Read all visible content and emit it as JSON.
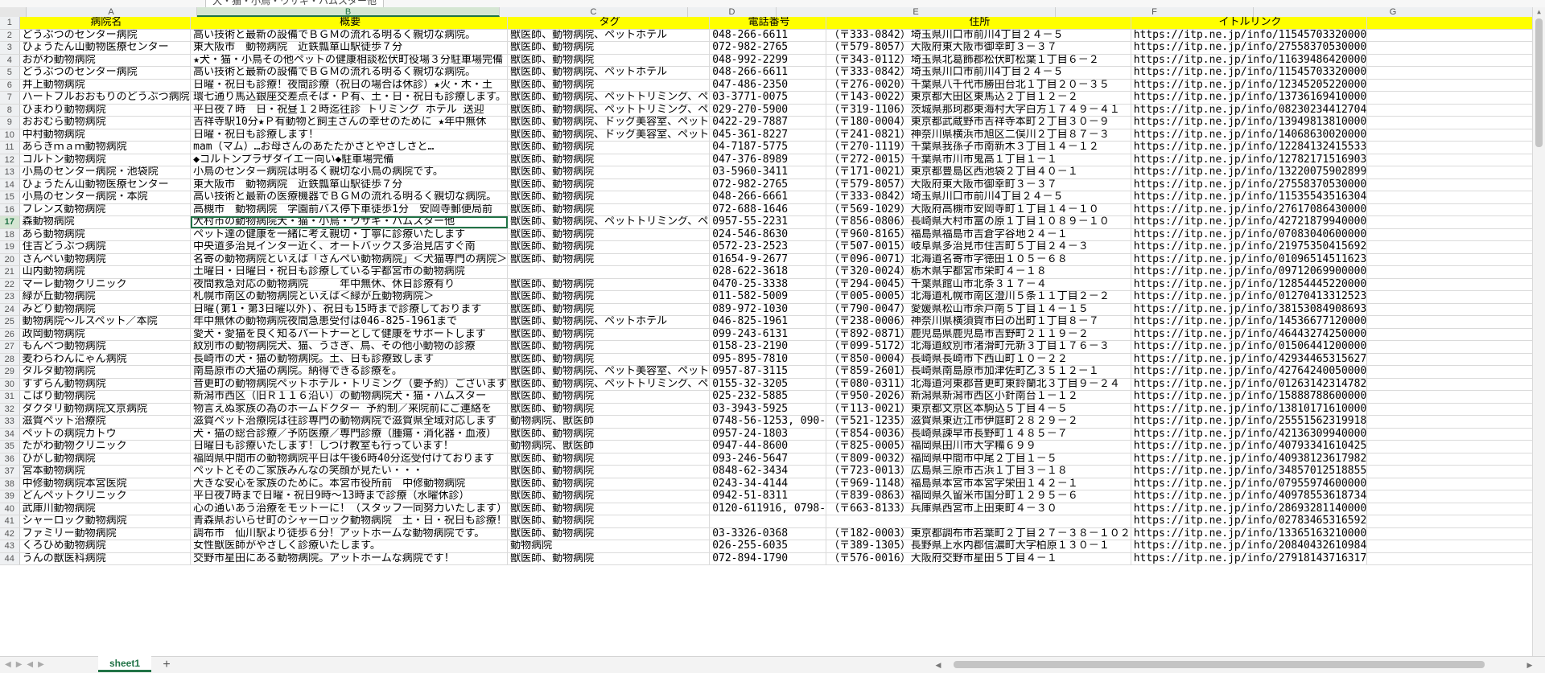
{
  "formula_bar": {
    "text": "犬・猫・小鳥・ウサギ・ハムスター他"
  },
  "column_letters": [
    "A",
    "B",
    "C",
    "D",
    "E",
    "F",
    "G"
  ],
  "header_row_number": "1",
  "headers": [
    "病院名",
    "概要",
    "タグ",
    "電話番号",
    "住所",
    "イトルリンク"
  ],
  "rows": [
    {
      "n": "2",
      "c": [
        "どうぶつのセンター病院",
        "高い技術と最新の設備でＢＧＭの流れる明るく親切な病院。",
        "獣医師、動物病院、ペットホテル",
        "048-266-6611",
        "（〒333-0842）埼玉県川口市前川4丁目２４－５",
        "https://itp.ne.jp/info/11545703320000"
      ]
    },
    {
      "n": "3",
      "c": [
        "ひょうたん山動物医療センター",
        "東大阪市　動物病院　近鉄瓢箪山駅徒歩７分",
        "獣医師、動物病院",
        "072-982-2765",
        "（〒579-8057）大阪府東大阪市御幸町３－３７",
        "https://itp.ne.jp/info/27558370530000"
      ]
    },
    {
      "n": "4",
      "c": [
        "おがわ動物病院",
        "★犬・猫・小鳥その他ペットの健康相談松伏町役場３分駐車場完備",
        "獣医師、動物病院",
        "048-992-2299",
        "（〒343-0112）埼玉県北葛飾郡松伏町松葉１丁目６－２",
        "https://itp.ne.jp/info/11639486420000"
      ]
    },
    {
      "n": "5",
      "c": [
        "どうぶつのセンター病院",
        "高い技術と最新の設備でＢＧＭの流れる明るく親切な病院。",
        "獣医師、動物病院、ペットホテル",
        "048-266-6611",
        "（〒333-0842）埼玉県川口市前川4丁目２４－５",
        "https://itp.ne.jp/info/11545703320000"
      ]
    },
    {
      "n": "6",
      "c": [
        "井上動物病院",
        "日曜・祝日も診療！夜間診療（祝日の場合は休診）★火・木・土",
        "獣医師、動物病院",
        "047-486-2350",
        "（〒276-0020）千葉県八千代市勝田台北１丁目２０－３５",
        "https://itp.ne.jp/info/12345205220000"
      ]
    },
    {
      "n": "7",
      "c": [
        "ハートフルおおもりのどうぶつ病院",
        "環七通り馬込銀座交差点そば・Ｐ有、土・日・祝日も診療します。",
        "獣医師、動物病院、ペットトリミング、ペ",
        "03-3771-0075",
        "（〒143-0022）東京都大田区東馬込２丁目１２－２",
        "https://itp.ne.jp/info/13736169410000"
      ]
    },
    {
      "n": "8",
      "c": [
        "ひまわり動物病院",
        "平日夜７時　日・祝昼１２時迄往診 トリミング ホテル 送迎",
        "獣医師、動物病院、ペットトリミング、ペ",
        "029-270-5900",
        "（〒319-1106）茨城県那珂郡東海村大字白方１７４９－４１",
        "https://itp.ne.jp/info/08230234412704"
      ]
    },
    {
      "n": "9",
      "c": [
        "おおむら動物病院",
        "吉祥寺駅10分★Ｐ有動物と飼主さんの幸せのために ★年中無休",
        "獣医師、動物病院、ドッグ美容室、ペット",
        "0422-29-7887",
        "（〒180-0004）東京都武蔵野市吉祥寺本町２丁目３０－９",
        "https://itp.ne.jp/info/13949813810000"
      ]
    },
    {
      "n": "10",
      "c": [
        "中村動物病院",
        "日曜・祝日も診療します！",
        "獣医師、動物病院、ドッグ美容室、ペット",
        "045-361-8227",
        "（〒241-0821）神奈川県横浜市旭区二俣川２丁目８７－３",
        "https://itp.ne.jp/info/14068630020000"
      ]
    },
    {
      "n": "11",
      "c": [
        "あらきｍａｍ動物病院",
        "mam（マム）…お母さんのあたたかさとやさしさと…",
        "獣医師、動物病院",
        "04-7187-5775",
        "（〒270-1119）千葉県我孫子市南新木３丁目１４－１２",
        "https://itp.ne.jp/info/12284132415533"
      ]
    },
    {
      "n": "12",
      "c": [
        "コルトン動物病院",
        "◆コルトンプラザダイエー向い◆駐車場完備",
        "獣医師、動物病院",
        "047-376-8989",
        "（〒272-0015）千葉県市川市鬼高１丁目１－１",
        "https://itp.ne.jp/info/12782171516903"
      ]
    },
    {
      "n": "13",
      "c": [
        "小鳥のセンター病院・池袋院",
        "小鳥のセンター病院は明るく親切な小鳥の病院です。",
        "獣医師、動物病院",
        "03-5960-3411",
        "（〒171-0021）東京都豊島区西池袋２丁目４０－１",
        "https://itp.ne.jp/info/13220075902899"
      ]
    },
    {
      "n": "14",
      "c": [
        "ひょうたん山動物医療センター",
        "東大阪市　動物病院　近鉄瓢箪山駅徒歩７分",
        "獣医師、動物病院",
        "072-982-2765",
        "（〒579-8057）大阪府東大阪市御幸町３－３７",
        "https://itp.ne.jp/info/27558370530000"
      ]
    },
    {
      "n": "15",
      "c": [
        "小鳥のセンター病院・本院",
        "高い技術と最新の医療機器でＢＧＭの流れる明るく親切な病院。",
        "獣医師、動物病院",
        "048-266-6661",
        "（〒333-0842）埼玉県川口市前川4丁目２４－５",
        "https://itp.ne.jp/info/11535543516304"
      ]
    },
    {
      "n": "16",
      "c": [
        "フレンズ動物病院",
        "高槻市　動物病院　学園前バス停下車徒歩1分　安岡寺郵便局前",
        "獣医師、動物病院",
        "072-688-1646",
        "（〒569-1029）大阪府高槻市安岡寺町１丁目１４－１０",
        "https://itp.ne.jp/info/27617086430000"
      ]
    },
    {
      "n": "17",
      "c": [
        "森動物病院",
        "大村市の動物病院犬・猫・小鳥・ウサギ・ハムスター他",
        "獣医師、動物病院、ペットトリミング、ペ",
        "0957-55-2231",
        "（〒856-0806）長崎県大村市富の原１丁目１０８９－１０",
        "https://itp.ne.jp/info/42721879940000"
      ]
    },
    {
      "n": "18",
      "c": [
        "あら動物病院",
        "ペット達の健康を一緒に考え親切・丁寧に診療いたします",
        "獣医師、動物病院",
        "024-546-8630",
        "（〒960-8165）福島県福島市吉倉字谷地２４－１",
        "https://itp.ne.jp/info/07083040600000"
      ]
    },
    {
      "n": "19",
      "c": [
        "住吉どうぶつ病院",
        "中央道多治見インター近く、オートバックス多治見店すぐ南",
        "獣医師、動物病院",
        "0572-23-2523",
        "（〒507-0015）岐阜県多治見市住吉町５丁目２４－３",
        "https://itp.ne.jp/info/21975350415692"
      ]
    },
    {
      "n": "20",
      "c": [
        "さんぺい動物病院",
        "名寄の動物病院といえば「さんぺい動物病院」＜犬猫専門の病院＞",
        "獣医師、動物病院",
        "01654-9-2677",
        "（〒096-0071）北海道名寄市字徳田１０５－６８",
        "https://itp.ne.jp/info/01096514511623"
      ]
    },
    {
      "n": "21",
      "c": [
        "山内動物病院",
        "土曜日・日曜日・祝日も診療している宇都宮市の動物病院",
        "",
        "028-622-3618",
        "（〒320-0024）栃木県宇都宮市栄町４－１８",
        "https://itp.ne.jp/info/09712069900000"
      ]
    },
    {
      "n": "22",
      "c": [
        "マーレ動物クリニック",
        "夜間救急対応の動物病院　　　年中無休、休日診療有り",
        "獣医師、動物病院",
        "0470-25-3338",
        "（〒294-0045）千葉県館山市北条３１７－４",
        "https://itp.ne.jp/info/12854445220000"
      ]
    },
    {
      "n": "23",
      "c": [
        "緑が丘動物病院",
        "札幌市南区の動物病院といえば＜緑が丘動物病院＞",
        "獣医師、動物病院",
        "011-582-5009",
        "（〒005-0005）北海道札幌市南区澄川５条１１丁目２－２",
        "https://itp.ne.jp/info/01270413312523"
      ]
    },
    {
      "n": "24",
      "c": [
        "みどり動物病院",
        "日曜(第1・第3日曜以外)、祝日も15時まで診療しております",
        "獣医師、動物病院",
        "089-972-1030",
        "（〒790-0047）愛媛県松山市余戸南５丁目１４－１５",
        "https://itp.ne.jp/info/38153084908693"
      ]
    },
    {
      "n": "25",
      "c": [
        "動物病院～ルスペット／本院",
        "年中無休の動物病院夜間急患受付は046-825-1961まで",
        "獣医師、動物病院、ペットホテル",
        "046-825-1961",
        "（〒238-0006）神奈川県横須賀市日の出町１丁目８－７",
        "https://itp.ne.jp/info/14536677120000"
      ]
    },
    {
      "n": "26",
      "c": [
        "政岡動物病院",
        "愛犬・愛猫を良く知るパートナーとして健康をサポートします",
        "獣医師、動物病院",
        "099-243-6131",
        "（〒892-0871）鹿児島県鹿児島市吉野町２１１９－２",
        "https://itp.ne.jp/info/46443274250000"
      ]
    },
    {
      "n": "27",
      "c": [
        "もんべつ動物病院",
        "紋別市の動物病院犬、猫、うさぎ、鳥、その他小動物の診療",
        "獣医師、動物病院",
        "0158-23-2190",
        "（〒099-5172）北海道紋別市渚滑町元新３丁目１７６－３",
        "https://itp.ne.jp/info/01506441200000"
      ]
    },
    {
      "n": "28",
      "c": [
        "麦わらわんにゃん病院",
        "長崎市の犬・猫の動物病院。土、日も診療致します",
        "獣医師、動物病院",
        "095-895-7810",
        "（〒850-0004）長崎県長崎市下西山町１０－２２",
        "https://itp.ne.jp/info/42934465315627"
      ]
    },
    {
      "n": "29",
      "c": [
        "タルタ動物病院",
        "南島原市の犬猫の病院。納得できる診療を。",
        "獣医師、動物病院、ペット美容室、ペット",
        "0957-87-3115",
        "（〒859-2601）長崎県南島原市加津佐町乙３５１２－１",
        "https://itp.ne.jp/info/42764240050000"
      ]
    },
    {
      "n": "30",
      "c": [
        "すずらん動物病院",
        "音更町の動物病院ペットホテル・トリミング（要予約）ございます",
        "獣医師、動物病院、ペットトリミング、ペ",
        "0155-32-3205",
        "（〒080-0311）北海道河東郡音更町東鈴蘭北３丁目９－２４",
        "https://itp.ne.jp/info/01263142314782"
      ]
    },
    {
      "n": "31",
      "c": [
        "こばり動物病院",
        "新潟市西区（旧Ｒ１１６沿い）の動物病院犬・猫・ハムスター",
        "獣医師、動物病院",
        "025-232-5885",
        "（〒950-2026）新潟県新潟市西区小針南台１－１２",
        "https://itp.ne.jp/info/15888788600000"
      ]
    },
    {
      "n": "32",
      "c": [
        "ダクタリ動物病院文京病院",
        "物言えぬ家族の為のホームドクター 予約制／来院前にご連絡を",
        "獣医師、動物病院",
        "03-3943-5925",
        "（〒113-0021）東京都文京区本駒込５丁目４－５",
        "https://itp.ne.jp/info/13810171610000"
      ]
    },
    {
      "n": "33",
      "c": [
        "滋賀ペット治療院",
        "滋賀ペット治療院は往診専門の動物病院で滋賀県全域対応します",
        "動物病院、獣医師",
        "0748-56-1253, 090-",
        "（〒521-1235）滋賀県東近江市伊庭町２８２９－２",
        "https://itp.ne.jp/info/25551562319918"
      ]
    },
    {
      "n": "34",
      "c": [
        "ペットの病院カトウ",
        "犬・猫の総合診療／予防医療／専門診療（腫瘍・消化器・血液）",
        "獣医師、動物病院",
        "0957-24-1803",
        "（〒854-0036）長崎県諫早市長野町１４８５－７",
        "https://itp.ne.jp/info/42136309940000"
      ]
    },
    {
      "n": "35",
      "c": [
        "たがわ動物クリニック",
        "日曜日も診療いたします！しつけ教室も行っています！",
        "動物病院、獣医師",
        "0947-44-8600",
        "（〒825-0005）福岡県田川市大字糒６９９",
        "https://itp.ne.jp/info/40793341610425"
      ]
    },
    {
      "n": "36",
      "c": [
        "ひがし動物病院",
        "福岡県中間市の動物病院平日は午後6時40分迄受付けております",
        "獣医師、動物病院",
        "093-246-5647",
        "（〒809-0032）福岡県中間市中尾２丁目１－５",
        "https://itp.ne.jp/info/40938123617982"
      ]
    },
    {
      "n": "37",
      "c": [
        "宮本動物病院",
        "ペットとそのご家族みんなの笑顔が見たい・・・",
        "獣医師、動物病院",
        "0848-62-3434",
        "（〒723-0013）広島県三原市古浜１丁目３－１８",
        "https://itp.ne.jp/info/34857012518855"
      ]
    },
    {
      "n": "38",
      "c": [
        "中修動物病院本宮医院",
        "大きな安心を家族のために。本宮市役所前　中修動物病院",
        "獣医師、動物病院",
        "0243-34-4144",
        "（〒969-1148）福島県本宮市本宮字栄田１４２－１",
        "https://itp.ne.jp/info/07955974600000"
      ]
    },
    {
      "n": "39",
      "c": [
        "どんペットクリニック",
        "平日夜7時まで日曜・祝日9時～13時まで診療（水曜休診）",
        "獣医師、動物病院",
        "0942-51-8311",
        "（〒839-0863）福岡県久留米市国分町１２９５－６",
        "https://itp.ne.jp/info/40978553618734"
      ]
    },
    {
      "n": "40",
      "c": [
        "武庫川動物病院",
        "心の通いあう治療をモットーに！（スタッフ一同努力いたします）",
        "獣医師、動物病院",
        "0120-611916, 0798-",
        "（〒663-8133）兵庫県西宮市上田東町４－３０",
        "https://itp.ne.jp/info/28693281140000"
      ]
    },
    {
      "n": "41",
      "c": [
        "シャーロック動物病院",
        "青森県おいらせ町のシャーロック動物病院　土・日・祝日も診療！",
        "獣医師、動物病院",
        "",
        "",
        "https://itp.ne.jp/info/02783465316592"
      ]
    },
    {
      "n": "42",
      "c": [
        "ファミリー動物病院",
        "調布市　仙川駅より徒歩６分！アットホームな動物病院です。",
        "獣医師、動物病院",
        "03-3326-0368",
        "（〒182-0003）東京都調布市若葉町２丁目２７－３８－１０２",
        "https://itp.ne.jp/info/13365163210000"
      ]
    },
    {
      "n": "43",
      "c": [
        "くろひめ動物病院",
        "女性獣医師がやさしく診療いたします。",
        "動物病院",
        "026-255-6035",
        "（〒389-1305）長野県上水内郡信濃町大字柏原１３０－１",
        "https://itp.ne.jp/info/20840432610984"
      ]
    },
    {
      "n": "44",
      "c": [
        "うんの獣医科病院",
        "交野市星田にある動物病院。アットホームな病院です！",
        "獣医師、動物病院",
        "072-894-1790",
        "（〒576-0016）大阪府交野市星田５丁目４－１",
        "https://itp.ne.jp/info/27918143716317"
      ]
    }
  ],
  "selected": {
    "row": "17",
    "column": "B"
  },
  "sheet_tab": {
    "label": "sheet1"
  },
  "colors": {
    "header_fill": "#ffff00",
    "accent": "#217346",
    "grid": "#d9d9d9"
  }
}
